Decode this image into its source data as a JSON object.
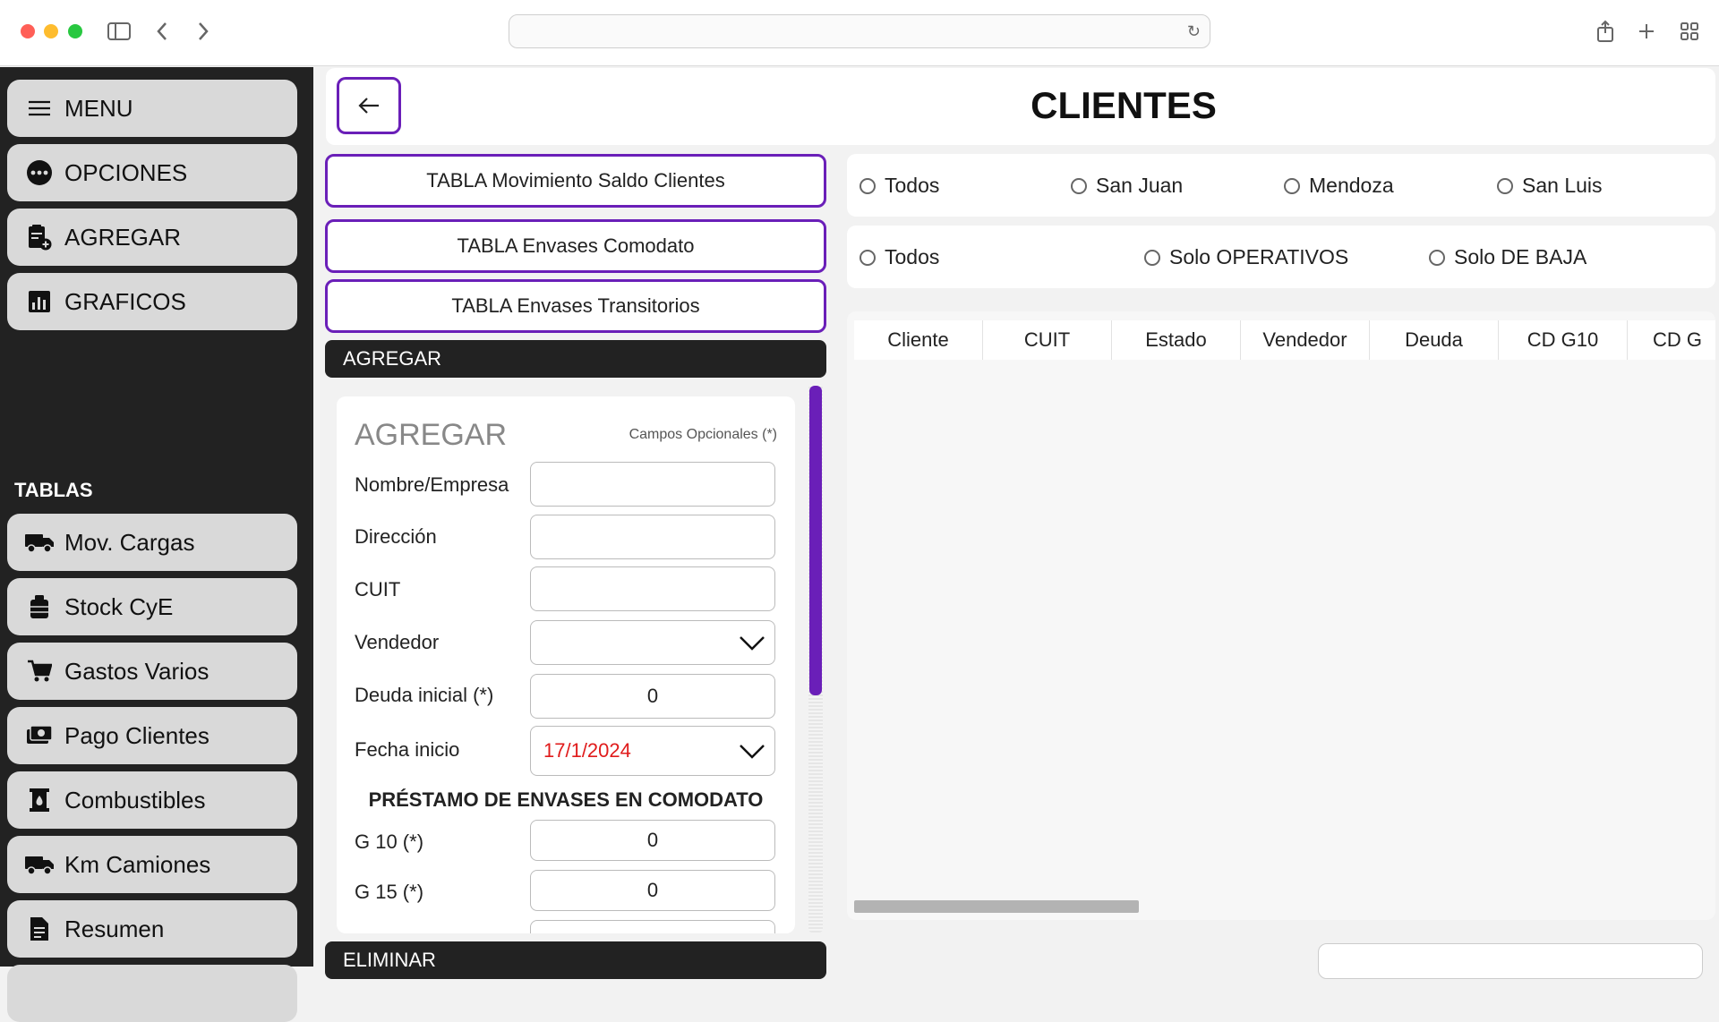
{
  "sidebar": {
    "top_items": [
      {
        "label": "MENU",
        "icon": "menu-icon"
      },
      {
        "label": "OPCIONES",
        "icon": "more-icon"
      },
      {
        "label": "AGREGAR",
        "icon": "add-document-icon"
      },
      {
        "label": "GRAFICOS",
        "icon": "chart-icon"
      }
    ],
    "section_label": "TABLAS",
    "table_items": [
      {
        "label": "Mov. Cargas",
        "icon": "truck-icon"
      },
      {
        "label": "Stock CyE",
        "icon": "box-icon"
      },
      {
        "label": "Gastos Varios",
        "icon": "cart-icon"
      },
      {
        "label": "Pago Clientes",
        "icon": "money-icon"
      },
      {
        "label": "Combustibles",
        "icon": "fuel-icon"
      },
      {
        "label": "Km Camiones",
        "icon": "truck-icon"
      },
      {
        "label": "Resumen",
        "icon": "document-icon"
      }
    ]
  },
  "header": {
    "title": "CLIENTES"
  },
  "table_buttons": [
    "TABLA Movimiento Saldo Clientes",
    "TABLA Envases Comodato",
    "TABLA Envases Transitorios"
  ],
  "sections": {
    "agregar": "AGREGAR",
    "eliminar": "ELIMINAR"
  },
  "form": {
    "title": "AGREGAR",
    "optional_note": "Campos Opcionales (*)",
    "fields": {
      "nombre": {
        "label": "Nombre/Empresa",
        "value": ""
      },
      "direccion": {
        "label": "Dirección",
        "value": ""
      },
      "cuit": {
        "label": "CUIT",
        "value": ""
      },
      "vendedor": {
        "label": "Vendedor",
        "value": ""
      },
      "deuda": {
        "label": "Deuda inicial (*)",
        "value": "0"
      },
      "fecha": {
        "label": "Fecha inicio",
        "value": "17/1/2024"
      },
      "g10": {
        "label": "G 10 (*)",
        "value": "0"
      },
      "g15": {
        "label": "G 15 (*)",
        "value": "0"
      }
    },
    "prestamo_heading": "PRÉSTAMO DE ENVASES EN COMODATO"
  },
  "filters": {
    "region": [
      "Todos",
      "San Juan",
      "Mendoza",
      "San Luis"
    ],
    "estado": [
      "Todos",
      "Solo OPERATIVOS",
      "Solo DE BAJA"
    ]
  },
  "table": {
    "columns": [
      "Cliente",
      "CUIT",
      "Estado",
      "Vendedor",
      "Deuda",
      "CD G10",
      "CD G"
    ]
  },
  "colors": {
    "accent": "#6a1fb8",
    "sidebar_bg": "#222222",
    "date_text": "#e01b1b"
  }
}
